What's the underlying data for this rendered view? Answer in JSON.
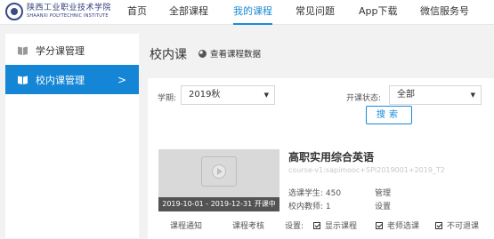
{
  "header": {
    "logo": {
      "name_cn": "陕西工业职业技术学院",
      "name_en": "SHAANXI POLYTECHNIC INSTITUTE"
    },
    "nav": [
      {
        "label": "首页",
        "active": false
      },
      {
        "label": "全部课程",
        "active": false
      },
      {
        "label": "我的课程",
        "active": true
      },
      {
        "label": "常见问题",
        "active": false
      },
      {
        "label": "App下载",
        "active": false
      },
      {
        "label": "微信服务号",
        "active": false
      }
    ]
  },
  "sidebar": {
    "items": [
      {
        "label": "学分课管理",
        "icon": "book-icon",
        "active": false
      },
      {
        "label": "校内课管理",
        "icon": "book-icon",
        "active": true,
        "chevron": ">"
      }
    ]
  },
  "main": {
    "title": "校内课",
    "view_data_label": "查看课程数据",
    "filters": {
      "term_label": "学期:",
      "term_value": "2019秋",
      "status_label": "开课状态:",
      "status_value": "全部",
      "search_label": "搜索"
    },
    "course": {
      "title": "高职实用综合英语",
      "code": "course-v1:sapimooc+SPI2019001+2019_T2",
      "date_badge": "2019-10-01 - 2019-12-31 开课中",
      "students_label": "选课学生:",
      "students_value": "450",
      "teachers_label": "校内教师:",
      "teachers_value": "1",
      "manage_label": "管理",
      "settings_label": "设置",
      "notice_label": "课程通知",
      "assessment_label": "课程考核",
      "settings_prefix": "设置:",
      "options": [
        {
          "label": "显示课程",
          "checked": true
        },
        {
          "label": "老师选课",
          "checked": true
        },
        {
          "label": "不可退课",
          "checked": true
        }
      ]
    }
  },
  "colors": {
    "accent": "#1a8ad6",
    "sidebar_active": "#1586d6",
    "background": "#f2f2f2"
  }
}
